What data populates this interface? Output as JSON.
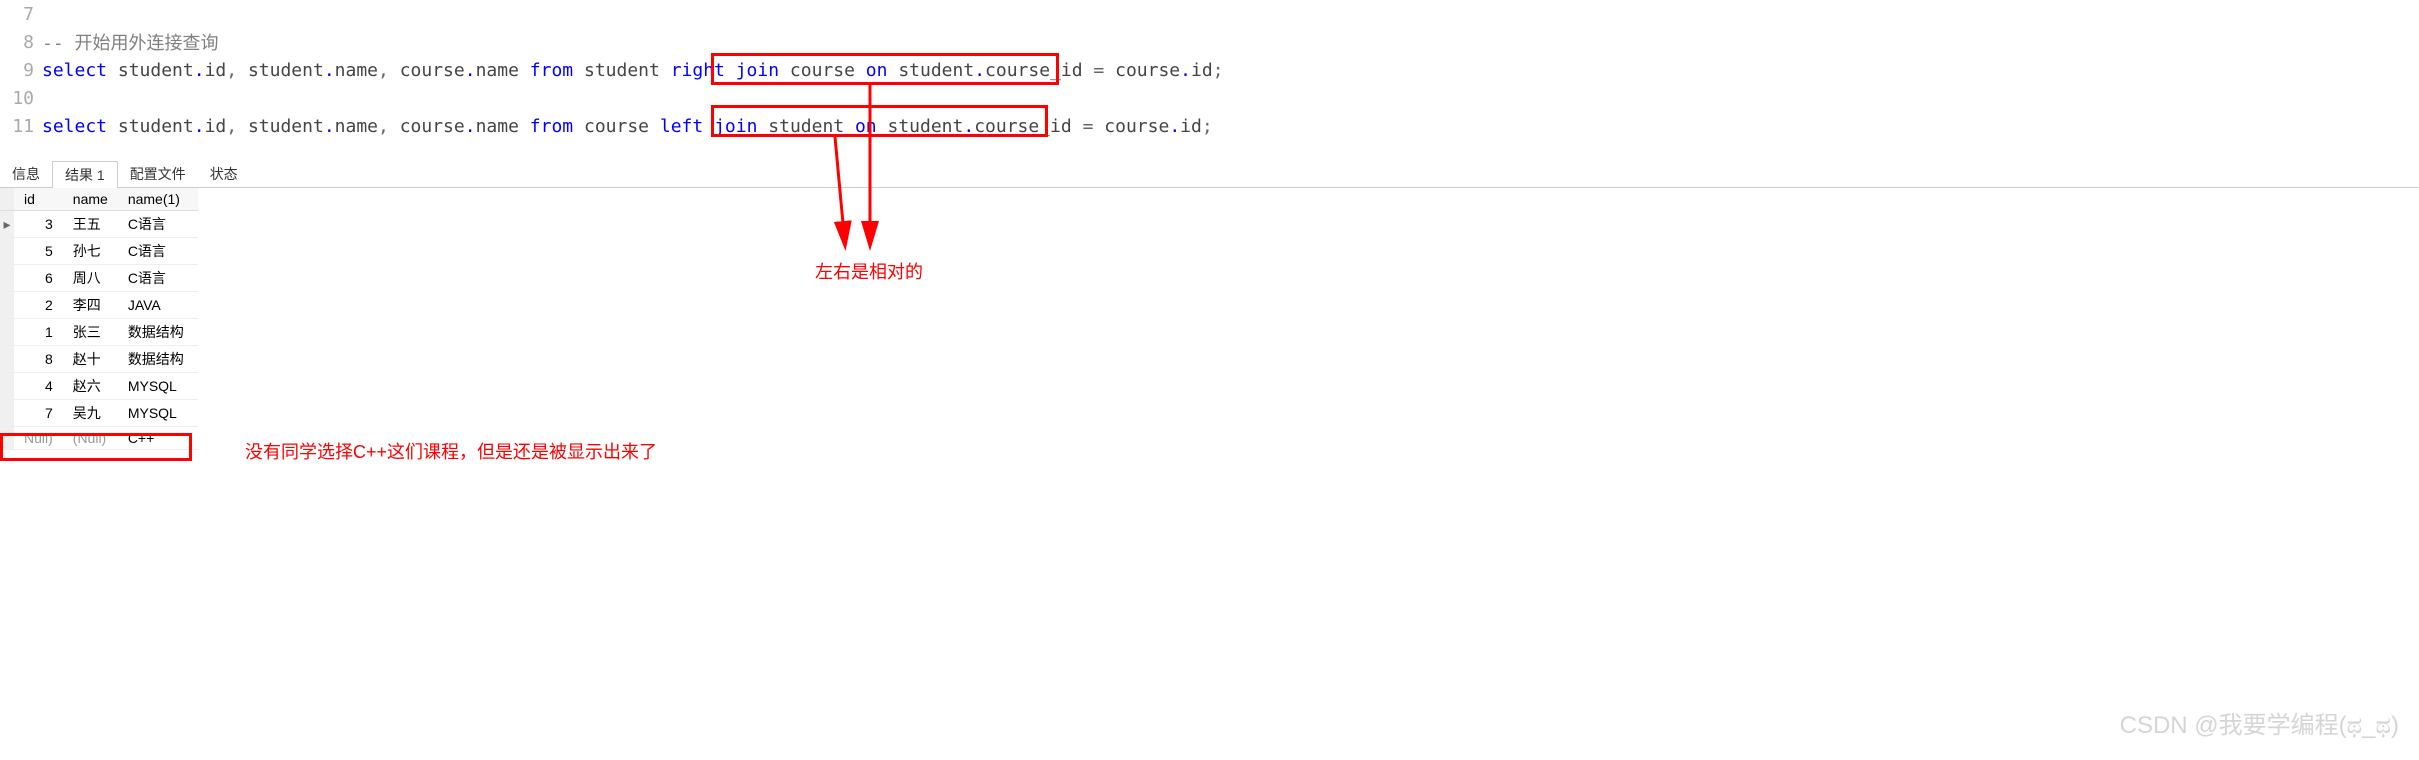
{
  "editor": {
    "lines": [
      {
        "num": "7",
        "type": "blank"
      },
      {
        "num": "8",
        "type": "comment",
        "text": "-- 开始用外连接查询"
      },
      {
        "num": "9",
        "type": "sql1"
      },
      {
        "num": "10",
        "type": "blank"
      },
      {
        "num": "11",
        "type": "sql2"
      }
    ],
    "sql1": {
      "select": "select",
      "student_id": "student",
      "id": "id",
      "student_name1": "student",
      "name1": "name",
      "course_name1": "course",
      "cname1": "name",
      "from": "from",
      "student": "student",
      "right": "right",
      "join": "join",
      "course": "course",
      "on": "on",
      "student_cid": "student",
      "course_id": "course_id",
      "course_id_tbl": "course",
      "cid": "id"
    },
    "sql2": {
      "select": "select",
      "student_id": "student",
      "id": "id",
      "student_name1": "student",
      "name1": "name",
      "course_name1": "course",
      "cname1": "name",
      "from": "from",
      "course": "course",
      "left": "left",
      "join": "join",
      "student": "student",
      "on": "on",
      "student_cid": "student",
      "course_id": "course_id",
      "course_id_tbl": "course",
      "cid": "id"
    }
  },
  "tabs": {
    "info": "信息",
    "result": "结果 1",
    "profile": "配置文件",
    "status": "状态"
  },
  "table": {
    "headers": {
      "id": "id",
      "name": "name",
      "name1": "name(1)"
    },
    "rows": [
      {
        "marker": "▸",
        "id": "3",
        "name": "王五",
        "name1": "C语言"
      },
      {
        "marker": "",
        "id": "5",
        "name": "孙七",
        "name1": "C语言"
      },
      {
        "marker": "",
        "id": "6",
        "name": "周八",
        "name1": "C语言"
      },
      {
        "marker": "",
        "id": "2",
        "name": "李四",
        "name1": "JAVA"
      },
      {
        "marker": "",
        "id": "1",
        "name": "张三",
        "name1": "数据结构"
      },
      {
        "marker": "",
        "id": "8",
        "name": "赵十",
        "name1": "数据结构"
      },
      {
        "marker": "",
        "id": "4",
        "name": "赵六",
        "name1": "MYSQL"
      },
      {
        "marker": "",
        "id": "7",
        "name": "吴九",
        "name1": "MYSQL"
      },
      {
        "marker": "",
        "id": "Null)",
        "name": "(Null)",
        "name1": "C++",
        "null": true
      }
    ]
  },
  "annotations": {
    "relative": "左右是相对的",
    "cpp_note": "没有同学选择C++这们课程，但是还是被显示出来了"
  },
  "watermark": "CSDN @我要学编程(ಥ_ಥ)"
}
